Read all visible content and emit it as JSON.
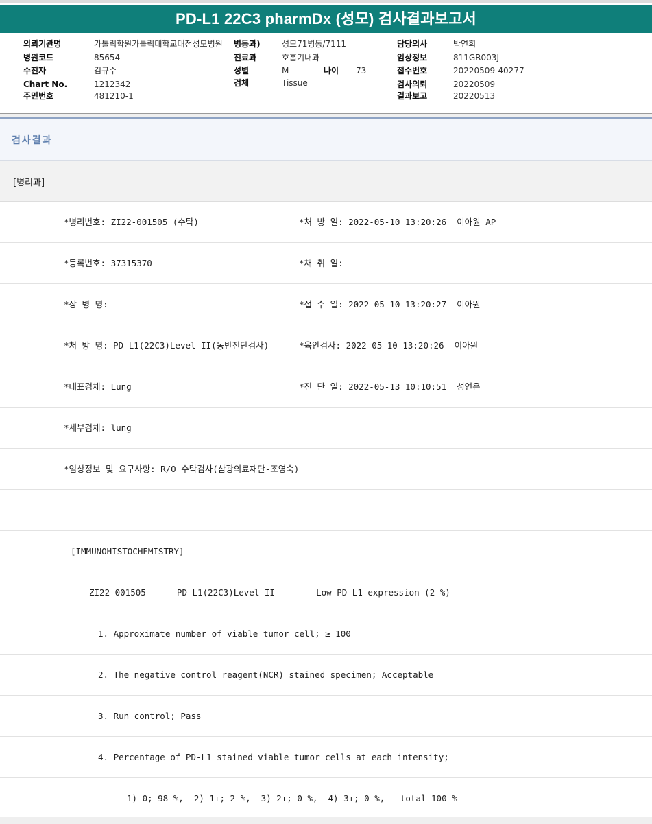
{
  "title": "PD-L1 22C3 pharmDx (성모) 검사결과보고서",
  "header": {
    "institution_label": "의뢰기관명",
    "institution_value": "가톨릭학원가톨릭대학교대전성모병원",
    "hospital_code_label": "병원코드",
    "hospital_code_value": "85654",
    "patient_label": "수진자",
    "patient_value": "김규수",
    "chart_label": "Chart No.",
    "chart_value": "1212342",
    "resident_label": "주민번호",
    "resident_value": "481210-1",
    "ward_label": "병동과)",
    "ward_value": "성모71병동/7111",
    "dept_label": "진료과",
    "dept_value": "호흡기내과",
    "sex_label": "성별",
    "sex_value": "M",
    "age_label": "나이",
    "age_value": "73",
    "specimen_label": "검체",
    "specimen_value": "Tissue",
    "doctor_label": "담당의사",
    "doctor_value": "박연희",
    "clinical_label": "임상정보",
    "clinical_value": "811GR003J",
    "receipt_label": "접수번호",
    "receipt_value": "20220509-40277",
    "request_label": "검사의뢰",
    "request_value": "20220509",
    "report_label": "결과보고",
    "report_value": "20220513"
  },
  "section_title": "검사결과",
  "department": "[병리과]",
  "rows": [
    {
      "left": "*병리번호: ZI22-001505 (수탁)",
      "right": "*처 방 일: 2022-05-10 13:20:26  이아원 AP"
    },
    {
      "left": "*등록번호: 37315370",
      "right": "*채 취 일:"
    },
    {
      "left": "*상 병 명: -",
      "right": "*접 수 일: 2022-05-10 13:20:27  이아원"
    },
    {
      "left": "*처 방 명: PD-L1(22C3)Level II(동반진단검사)",
      "right": "*육안검사: 2022-05-10 13:20:26  이아원"
    },
    {
      "left": "*대표검체: Lung",
      "right": "*진 단 일: 2022-05-13 10:10:51  성연은"
    },
    {
      "left": "*세부검체: lung",
      "right": ""
    },
    {
      "left": "*임상정보 및 요구사항: R/O 수탁검사(삼광의료재단-조영숙)",
      "right": ""
    },
    {
      "left": "",
      "right": ""
    },
    {
      "left": "[IMMUNOHISTOCHEMISTRY]",
      "right": ""
    },
    {
      "left": "ZI22-001505      PD-L1(22C3)Level II        Low PD-L1 expression (2 %)",
      "right": ""
    },
    {
      "left": "1. Approximate number of viable tumor cell; ≥ 100",
      "right": ""
    },
    {
      "left": "2. The negative control reagent(NCR) stained specimen; Acceptable",
      "right": ""
    },
    {
      "left": "3. Run control; Pass",
      "right": ""
    },
    {
      "left": "4. Percentage of PD-L1 stained viable tumor cells at each intensity;",
      "right": ""
    },
    {
      "left": "1) 0; 98 %,  2) 1+; 2 %,  3) 2+; 0 %,  4) 3+; 0 %,   total 100 %",
      "right": ""
    }
  ]
}
